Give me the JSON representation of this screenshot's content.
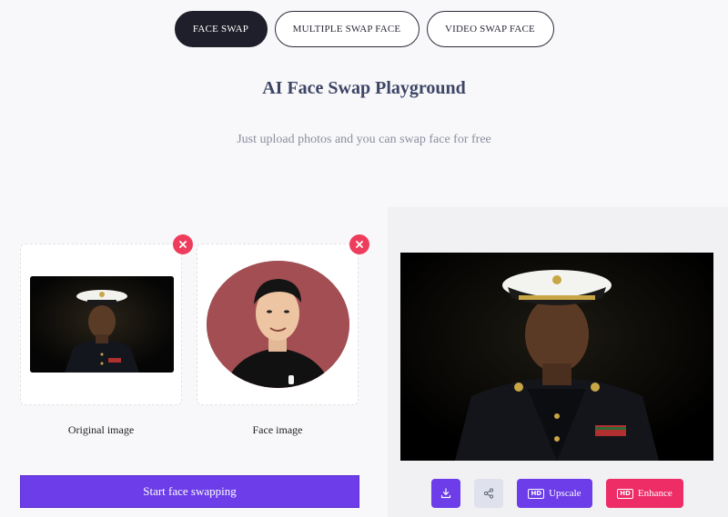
{
  "tabs": [
    {
      "label": "FACE SWAP",
      "active": true
    },
    {
      "label": "MULTIPLE SWAP FACE",
      "active": false
    },
    {
      "label": "VIDEO SWAP FACE",
      "active": false
    }
  ],
  "header": {
    "title": "AI Face Swap Playground",
    "subtitle": "Just upload photos and you can swap face for free"
  },
  "upload": {
    "original_caption": "Original image",
    "face_caption": "Face image",
    "start_label": "Start face swapping"
  },
  "result": {
    "actions": {
      "download_icon": "download-icon",
      "share_icon": "share-icon",
      "upscale_badge": "HD",
      "upscale_label": "Upscale",
      "enhance_badge": "HD",
      "enhance_label": "Enhance"
    }
  },
  "colors": {
    "accent": "#6c3de8",
    "danger": "#ee3d5c",
    "enhance": "#ee2d67",
    "active_tab": "#1e1f2b"
  }
}
